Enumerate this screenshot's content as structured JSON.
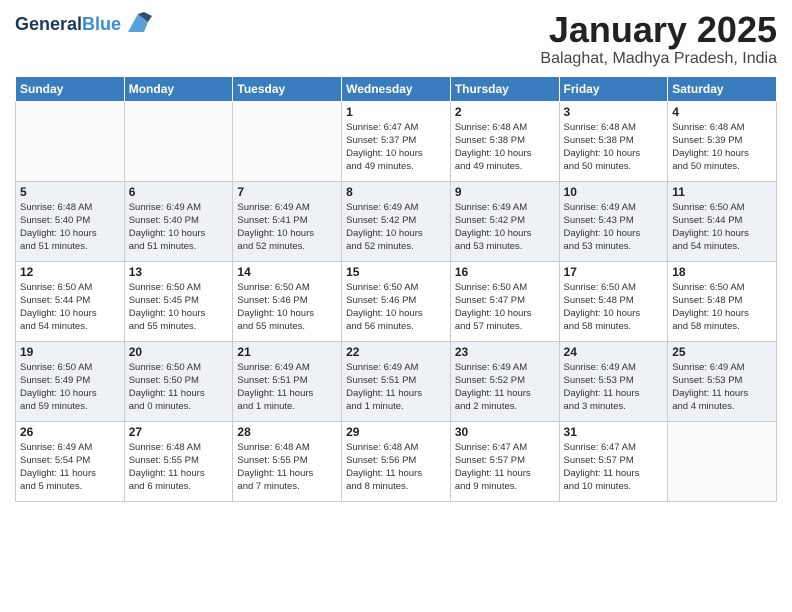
{
  "header": {
    "logo_line1": "General",
    "logo_line2": "Blue",
    "month_title": "January 2025",
    "subtitle": "Balaghat, Madhya Pradesh, India"
  },
  "days_of_week": [
    "Sunday",
    "Monday",
    "Tuesday",
    "Wednesday",
    "Thursday",
    "Friday",
    "Saturday"
  ],
  "weeks": [
    [
      {
        "day": "",
        "info": ""
      },
      {
        "day": "",
        "info": ""
      },
      {
        "day": "",
        "info": ""
      },
      {
        "day": "1",
        "info": "Sunrise: 6:47 AM\nSunset: 5:37 PM\nDaylight: 10 hours\nand 49 minutes."
      },
      {
        "day": "2",
        "info": "Sunrise: 6:48 AM\nSunset: 5:38 PM\nDaylight: 10 hours\nand 49 minutes."
      },
      {
        "day": "3",
        "info": "Sunrise: 6:48 AM\nSunset: 5:38 PM\nDaylight: 10 hours\nand 50 minutes."
      },
      {
        "day": "4",
        "info": "Sunrise: 6:48 AM\nSunset: 5:39 PM\nDaylight: 10 hours\nand 50 minutes."
      }
    ],
    [
      {
        "day": "5",
        "info": "Sunrise: 6:48 AM\nSunset: 5:40 PM\nDaylight: 10 hours\nand 51 minutes."
      },
      {
        "day": "6",
        "info": "Sunrise: 6:49 AM\nSunset: 5:40 PM\nDaylight: 10 hours\nand 51 minutes."
      },
      {
        "day": "7",
        "info": "Sunrise: 6:49 AM\nSunset: 5:41 PM\nDaylight: 10 hours\nand 52 minutes."
      },
      {
        "day": "8",
        "info": "Sunrise: 6:49 AM\nSunset: 5:42 PM\nDaylight: 10 hours\nand 52 minutes."
      },
      {
        "day": "9",
        "info": "Sunrise: 6:49 AM\nSunset: 5:42 PM\nDaylight: 10 hours\nand 53 minutes."
      },
      {
        "day": "10",
        "info": "Sunrise: 6:49 AM\nSunset: 5:43 PM\nDaylight: 10 hours\nand 53 minutes."
      },
      {
        "day": "11",
        "info": "Sunrise: 6:50 AM\nSunset: 5:44 PM\nDaylight: 10 hours\nand 54 minutes."
      }
    ],
    [
      {
        "day": "12",
        "info": "Sunrise: 6:50 AM\nSunset: 5:44 PM\nDaylight: 10 hours\nand 54 minutes."
      },
      {
        "day": "13",
        "info": "Sunrise: 6:50 AM\nSunset: 5:45 PM\nDaylight: 10 hours\nand 55 minutes."
      },
      {
        "day": "14",
        "info": "Sunrise: 6:50 AM\nSunset: 5:46 PM\nDaylight: 10 hours\nand 55 minutes."
      },
      {
        "day": "15",
        "info": "Sunrise: 6:50 AM\nSunset: 5:46 PM\nDaylight: 10 hours\nand 56 minutes."
      },
      {
        "day": "16",
        "info": "Sunrise: 6:50 AM\nSunset: 5:47 PM\nDaylight: 10 hours\nand 57 minutes."
      },
      {
        "day": "17",
        "info": "Sunrise: 6:50 AM\nSunset: 5:48 PM\nDaylight: 10 hours\nand 58 minutes."
      },
      {
        "day": "18",
        "info": "Sunrise: 6:50 AM\nSunset: 5:48 PM\nDaylight: 10 hours\nand 58 minutes."
      }
    ],
    [
      {
        "day": "19",
        "info": "Sunrise: 6:50 AM\nSunset: 5:49 PM\nDaylight: 10 hours\nand 59 minutes."
      },
      {
        "day": "20",
        "info": "Sunrise: 6:50 AM\nSunset: 5:50 PM\nDaylight: 11 hours\nand 0 minutes."
      },
      {
        "day": "21",
        "info": "Sunrise: 6:49 AM\nSunset: 5:51 PM\nDaylight: 11 hours\nand 1 minute."
      },
      {
        "day": "22",
        "info": "Sunrise: 6:49 AM\nSunset: 5:51 PM\nDaylight: 11 hours\nand 1 minute."
      },
      {
        "day": "23",
        "info": "Sunrise: 6:49 AM\nSunset: 5:52 PM\nDaylight: 11 hours\nand 2 minutes."
      },
      {
        "day": "24",
        "info": "Sunrise: 6:49 AM\nSunset: 5:53 PM\nDaylight: 11 hours\nand 3 minutes."
      },
      {
        "day": "25",
        "info": "Sunrise: 6:49 AM\nSunset: 5:53 PM\nDaylight: 11 hours\nand 4 minutes."
      }
    ],
    [
      {
        "day": "26",
        "info": "Sunrise: 6:49 AM\nSunset: 5:54 PM\nDaylight: 11 hours\nand 5 minutes."
      },
      {
        "day": "27",
        "info": "Sunrise: 6:48 AM\nSunset: 5:55 PM\nDaylight: 11 hours\nand 6 minutes."
      },
      {
        "day": "28",
        "info": "Sunrise: 6:48 AM\nSunset: 5:55 PM\nDaylight: 11 hours\nand 7 minutes."
      },
      {
        "day": "29",
        "info": "Sunrise: 6:48 AM\nSunset: 5:56 PM\nDaylight: 11 hours\nand 8 minutes."
      },
      {
        "day": "30",
        "info": "Sunrise: 6:47 AM\nSunset: 5:57 PM\nDaylight: 11 hours\nand 9 minutes."
      },
      {
        "day": "31",
        "info": "Sunrise: 6:47 AM\nSunset: 5:57 PM\nDaylight: 11 hours\nand 10 minutes."
      },
      {
        "day": "",
        "info": ""
      }
    ]
  ]
}
